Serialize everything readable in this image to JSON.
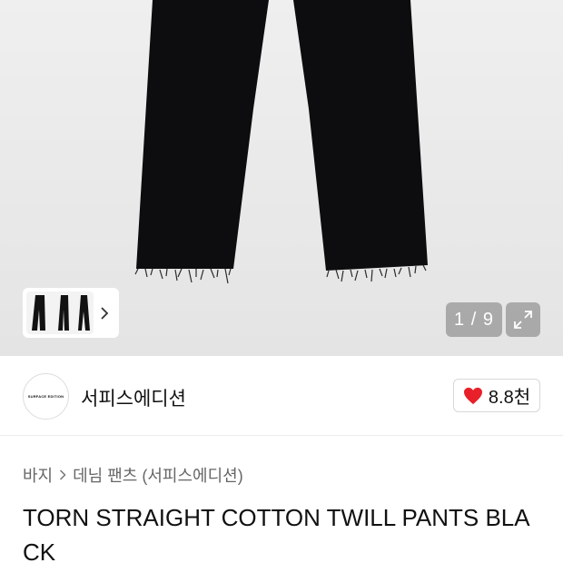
{
  "gallery": {
    "pager_text": "1 / 9",
    "current_index": 1,
    "total_images": 9,
    "thumbnail_more_icon": "chevron-right-icon",
    "expand_icon": "expand-icon"
  },
  "brand": {
    "logo_text": "SURFACE EDITION",
    "name": "서피스에디션"
  },
  "like": {
    "icon": "heart-icon",
    "count": "8.8천",
    "heart_color": "#e8202a"
  },
  "breadcrumb": [
    {
      "label": "바지"
    },
    {
      "label": "데님 팬츠 (서피스에디션)"
    }
  ],
  "product": {
    "title": "TORN STRAIGHT COTTON TWILL PANTS BLACK"
  }
}
